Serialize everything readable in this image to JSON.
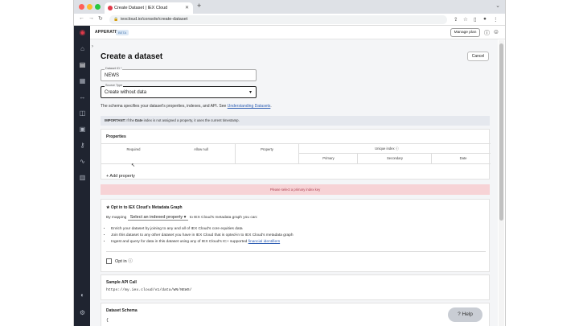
{
  "browser": {
    "tab_title": "Create Dataset | IEX Cloud",
    "url": "iexcloud.io/console/create-dataset"
  },
  "appbar": {
    "org": "APPERATE",
    "badge": "BETA",
    "manage_label": "Manage plan"
  },
  "page": {
    "title": "Create a dataset",
    "cancel_label": "Cancel",
    "dataset_id_label": "Dataset ID *",
    "dataset_id_value": "NEWS",
    "source_type_label": "Source Type",
    "source_type_value": "Create without data",
    "description": "The schema specifies your dataset's properties, indexes, and API. See",
    "description_link": "Understanding Datasets",
    "important_strong": "IMPORTANT:",
    "important_date": "Date",
    "important_pre": " If the ",
    "important_post": " index is not assigned a property, it uses the current timestamp."
  },
  "properties": {
    "title": "Properties",
    "col_required": "Required",
    "col_allow_null": "Allow null",
    "col_property": "Property",
    "col_unique_index": "Unique index ⓘ",
    "col_primary": "Primary",
    "col_secondary": "Secondary",
    "col_date": "Date",
    "add_label": "+ Add property"
  },
  "error_banner": "Please select a primary index key",
  "metadata": {
    "title": "★ Opt in to IEX Cloud's Metadata Graph",
    "mapping_pre": "By mapping",
    "select_label": "Select an indexed property",
    "mapping_post": "to IEX Cloud's metadata graph you can:",
    "bullets": [
      "Enrich your dataset by joining to any and all of IEX Cloud's core equities data",
      "Join this dataset to any other dataset you have in IEX Cloud that is opted-in to IEX Cloud's metadata graph",
      "Ingest and query for data in this dataset using any of IEX Cloud's IC+ supported "
    ],
    "bullet_link": "financial identifiers",
    "optin_label": "Opt in ⓘ"
  },
  "api": {
    "title": "Sample API Call",
    "url": "https://my.iex.cloud/v1/data/WN/NEWS/"
  },
  "schema": {
    "title": "Dataset Schema",
    "code": "{"
  },
  "help_label": "? Help"
}
